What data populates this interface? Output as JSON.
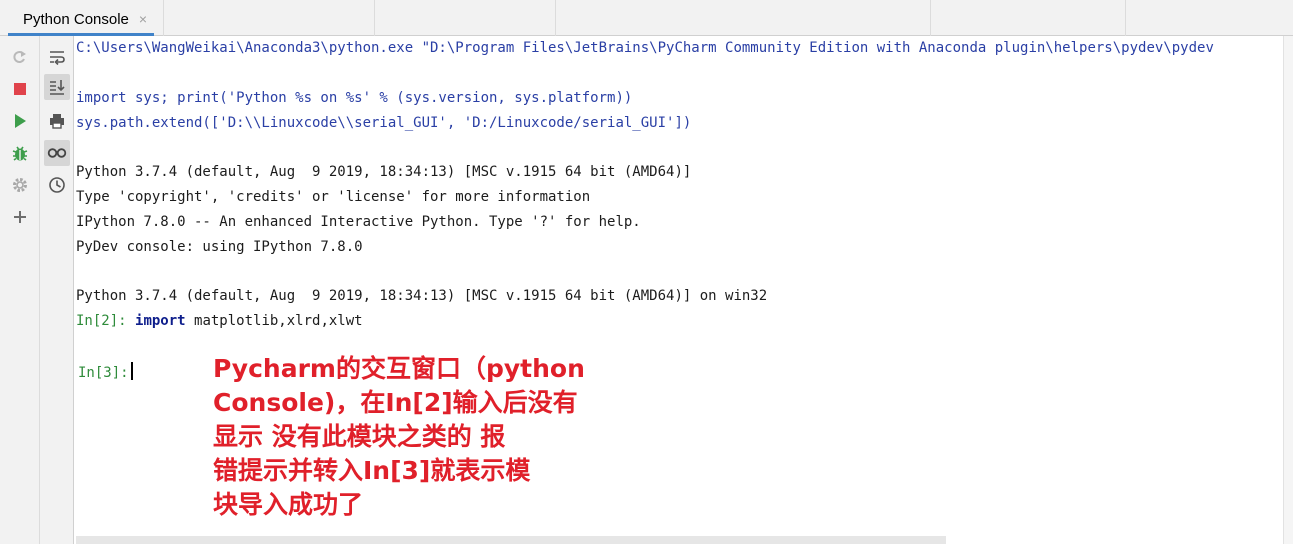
{
  "tab": {
    "title": "Python Console",
    "close_glyph": "×"
  },
  "toolbar_left": [
    "rerun-icon",
    "stop-icon",
    "run-icon",
    "debug-icon",
    "settings-icon",
    "add-icon"
  ],
  "toolbar_right": [
    "soft-wrap-icon",
    "scroll-to-end-icon",
    "print-icon",
    "show-variables-icon",
    "history-icon"
  ],
  "console": {
    "cmd_line": "C:\\Users\\WangWeikai\\Anaconda3\\python.exe \"D:\\Program Files\\JetBrains\\PyCharm Community Edition with Anaconda plugin\\helpers\\pydev\\pydev",
    "import_line": "import sys; print('Python %s on %s' % (sys.version, sys.platform))",
    "path_line": "sys.path.extend(['D:\\\\Linuxcode\\\\serial_GUI', 'D:/Linuxcode/serial_GUI'])",
    "python_version": "Python 3.7.4 (default, Aug  9 2019, 18:34:13) [MSC v.1915 64 bit (AMD64)]",
    "type_info": "Type 'copyright', 'credits' or 'license' for more information",
    "ipython_info": "IPython 7.8.0 -- An enhanced Interactive Python. Type '?' for help.",
    "pydev_info": "PyDev console: using IPython 7.8.0",
    "python_version_win": "Python 3.7.4 (default, Aug  9 2019, 18:34:13) [MSC v.1915 64 bit (AMD64)] on win32",
    "in2_prompt": "In[2]:",
    "in2_keyword": "import",
    "in2_rest": " matplotlib,xlrd,xlwt",
    "in3_prompt": "In[3]:"
  },
  "annotation": {
    "line1": "Pycharm的交互窗口（python",
    "line2": "Console)，在In[2]输入后没有",
    "line3": "显示 没有此模块之类的 报",
    "line4": "错提示并转入In[3]就表示模",
    "line5": "块导入成功了"
  },
  "colors": {
    "accent": "#4083c9",
    "annotation": "#e0202a",
    "prompt": "#2e8b3a",
    "code": "#2a3fa5",
    "stop": "#e0434b",
    "run": "#3e9e4c"
  }
}
